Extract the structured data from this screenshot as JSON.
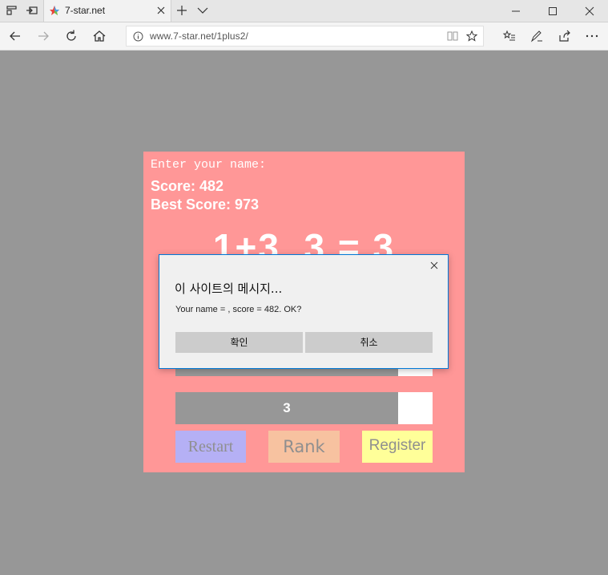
{
  "browser": {
    "tab_title": "7-star.net",
    "url": "www.7-star.net/1plus2/",
    "icons": [
      "tab-list-icon",
      "set-aside-icon",
      "favicon",
      "close-tab-icon",
      "new-tab-icon",
      "tab-menu-icon",
      "minimize-icon",
      "maximize-icon",
      "close-window-icon",
      "back-icon",
      "forward-icon",
      "refresh-icon",
      "home-icon",
      "info-icon",
      "reading-view-icon",
      "favorite-star-icon",
      "favorites-icon",
      "pen-icon",
      "share-icon",
      "more-icon"
    ]
  },
  "game": {
    "name_prompt": "Enter your name:",
    "score": "Score: 482",
    "best_score": "Best Score: 973",
    "question": "1+3, 3 = 3",
    "answers": [
      "",
      "3"
    ],
    "buttons": {
      "restart": "Restart",
      "rank": "Rank",
      "register": "Register"
    },
    "colors": {
      "panel": "#ff9797",
      "restart": "#b5b0f5",
      "rank": "#f7c2a0",
      "register": "#ffff99"
    }
  },
  "dialog": {
    "title": "이 사이트의 메시지...",
    "message": "Your name = , score = 482. OK?",
    "ok_label": "확인",
    "cancel_label": "취소"
  }
}
